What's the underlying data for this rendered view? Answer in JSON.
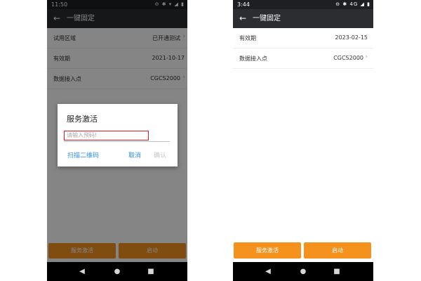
{
  "colors": {
    "accent": "#f5921d",
    "status_bar": "#1e1f22",
    "title_bar": "#2b2d31",
    "link_blue": "#2f8ff0",
    "input_error_border": "#d81b1b"
  },
  "left_screen": {
    "status_bar": {
      "time": "11:50",
      "icons": "⊖ ✱ ▾ ◢ ▮"
    },
    "title_bar": {
      "back_icon": "arrow-left",
      "title": "一键固定"
    },
    "rows": [
      {
        "label": "试用区域",
        "value": "已开通测试",
        "chevron": "›"
      },
      {
        "label": "有效期",
        "value": "2021-10-17"
      },
      {
        "label": "数据接入点",
        "value": "CGCS2000",
        "chevron": "›"
      }
    ],
    "dialog": {
      "title": "服务激活",
      "input_placeholder": "请输入预码!",
      "scan_label": "扫描二维码",
      "cancel_label": "取消",
      "confirm_label": "确认"
    },
    "buttons": {
      "activate_label": "服务激活",
      "start_label": "启动"
    }
  },
  "right_screen": {
    "status_bar": {
      "time": "3:44",
      "icons": "⊖ ✱ 4G ◢ ▮"
    },
    "title_bar": {
      "back_icon": "arrow-left",
      "title": "一键固定"
    },
    "rows": [
      {
        "label": "有效期",
        "value": "2023-02-15"
      },
      {
        "label": "数据接入点",
        "value": "CGCS2000",
        "chevron": "›"
      }
    ],
    "buttons": {
      "activate_label": "服务激活",
      "start_label": "启动"
    }
  },
  "nav_bar": {
    "back": "◀",
    "home": "●",
    "recents": "■"
  }
}
